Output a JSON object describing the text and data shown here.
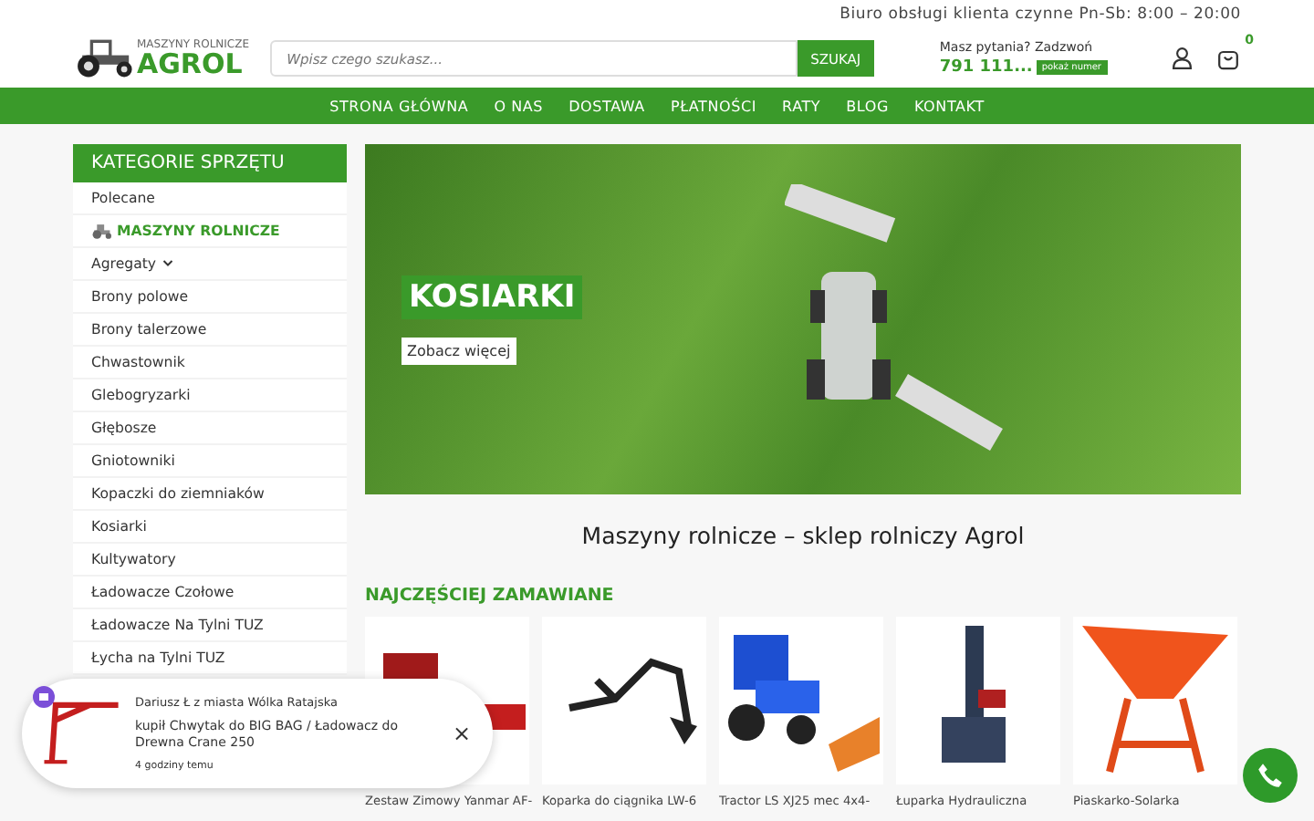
{
  "top_bar": {
    "text": "Biuro obsługi klienta czynne Pn-Sb: 8:00 – 20:00"
  },
  "header": {
    "logo": {
      "small": "MASZYNY ROLNICZE",
      "big": "AGROL"
    },
    "search": {
      "placeholder": "Wpisz czego szukasz...",
      "button": "SZUKAJ"
    },
    "contact": {
      "question": "Masz pytania? Zadzwoń",
      "phone": "791 111...",
      "show": "pokaż numer"
    },
    "cart_count": "0"
  },
  "nav": [
    "STRONA GŁÓWNA",
    "O NAS",
    "DOSTAWA",
    "PŁATNOŚCI",
    "RATY",
    "BLOG",
    "KONTAKT"
  ],
  "sidebar": {
    "title": "KATEGORIE SPRZĘTU",
    "items": [
      {
        "label": "Polecane",
        "kind": "plain"
      },
      {
        "label": "MASZYNY ROLNICZE",
        "kind": "heading"
      },
      {
        "label": "Agregaty",
        "kind": "dropdown"
      },
      {
        "label": "Brony polowe",
        "kind": "plain"
      },
      {
        "label": "Brony talerzowe",
        "kind": "plain"
      },
      {
        "label": "Chwastownik",
        "kind": "plain"
      },
      {
        "label": "Glebogryzarki",
        "kind": "plain"
      },
      {
        "label": "Głębosze",
        "kind": "plain"
      },
      {
        "label": "Gniotowniki",
        "kind": "plain"
      },
      {
        "label": "Kopaczki do ziemniaków",
        "kind": "plain"
      },
      {
        "label": "Kosiarki",
        "kind": "plain"
      },
      {
        "label": "Kultywatory",
        "kind": "plain"
      },
      {
        "label": "Ładowacze Czołowe",
        "kind": "plain"
      },
      {
        "label": "Ładowacze Na Tylni TUZ",
        "kind": "plain"
      },
      {
        "label": "Łycha na Tylni TUZ",
        "kind": "plain"
      }
    ]
  },
  "banner": {
    "title": "KOSIARKI",
    "button": "Zobacz więcej"
  },
  "page_title": "Maszyny rolnicze – sklep rolniczy Agrol",
  "section_title": "NAJCZĘŚCIEJ ZAMAWIANE",
  "products": [
    {
      "name": "Zestaw Zimowy Yanmar AF-",
      "kind": "tractor-plow"
    },
    {
      "name": "Koparka do ciągnika LW-6",
      "kind": "backhoe"
    },
    {
      "name": "Tractor LS XJ25 mec 4x4-",
      "kind": "tractor-blue"
    },
    {
      "name": "Łuparka Hydrauliczna",
      "kind": "splitter"
    },
    {
      "name": "Piaskarko-Solarka",
      "kind": "spreader"
    }
  ],
  "notification": {
    "who": "Dariusz Ł z miasta Wólka Ratajska",
    "what": "kupił Chwytak do BIG BAG / Ładowacz do Drewna Crane 250",
    "when": "4 godziny temu",
    "close": "×"
  }
}
